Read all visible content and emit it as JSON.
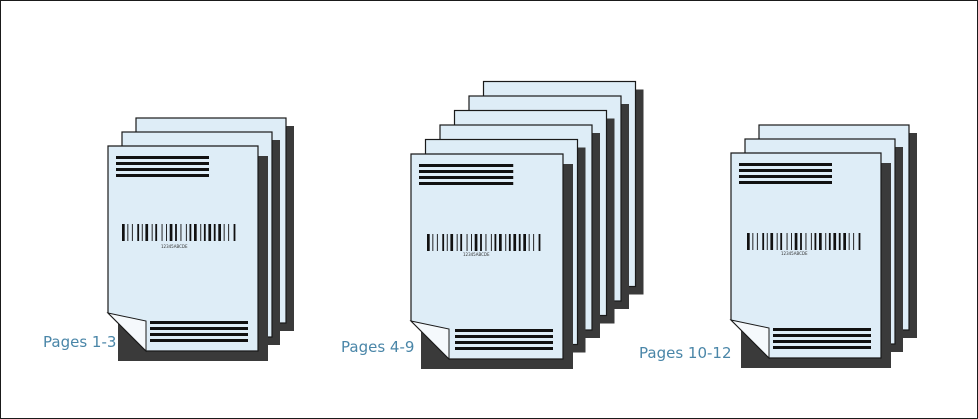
{
  "stacks": [
    {
      "label": "Pages 1-3",
      "barcode_text": "12345ABCDE"
    },
    {
      "label": "Pages 4-9",
      "barcode_text": "12345ABCDE"
    },
    {
      "label": "Pages 10-12",
      "barcode_text": "12345ABCDE"
    }
  ],
  "colors": {
    "page_fill": "#deedf7",
    "page_stroke": "#1a1a1a",
    "shadow": "#3a3a3a",
    "label": "#4a86a8",
    "bars": "#111111"
  }
}
